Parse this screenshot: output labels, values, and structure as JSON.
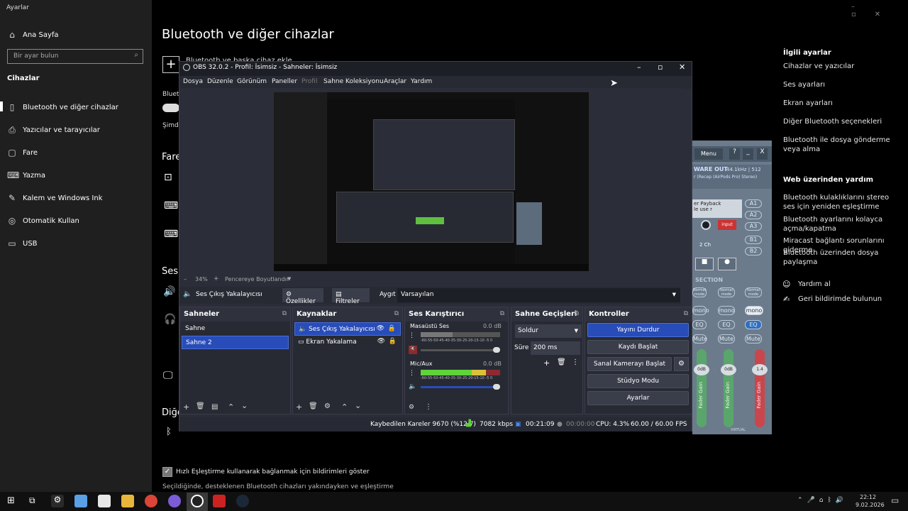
{
  "settings": {
    "window_title": "Ayarlar",
    "home": "Ana Sayfa",
    "search_placeholder": "Bir ayar bulun",
    "category": "Cihazlar",
    "nav": [
      "Bluetooth ve diğer cihazlar",
      "Yazıcılar ve tarayıcılar",
      "Fare",
      "Yazma",
      "Kalem ve Windows Ink",
      "Otomatik Kullan",
      "USB"
    ],
    "page_title": "Bluetooth ve diğer cihazlar",
    "add_device_partial": "Bluetooth ve başka cihaz ekle",
    "bluetooth_partial": "Blueto",
    "simdi_partial": "Şimdi",
    "fare_partial": "Fare",
    "ses_partial": "Ses",
    "diger_partial": "Diğe",
    "swift_pair_label": "Hızlı Eşleştirme kullanarak bağlanmak için bildirimleri göster",
    "swift_pair_desc": "Seçildiğinde, desteklenen Bluetooth cihazları yakındayken ve eşleştirme",
    "related_title": "İlgili ayarlar",
    "related": [
      "Cihazlar ve yazıcılar",
      "Ses ayarları",
      "Ekran ayarları",
      "Diğer Bluetooth seçenekleri",
      "Bluetooth ile dosya gönderme veya alma"
    ],
    "web_help_title": "Web üzerinden yardım",
    "web_help": [
      "Bluetooth kulaklıklarını stereo ses için yeniden eşleştirme",
      "Bluetooth ayarlarını kolayca açma/kapatma",
      "Miracast bağlantı sorunlarını giderme",
      "Bluetooth üzerinden dosya paylaşma"
    ],
    "get_help": "Yardım al",
    "feedback": "Geri bildirimde bulunun"
  },
  "obs": {
    "title": "OBS 32.0.2 - Profil: İsimsiz - Sahneler: İsimsiz",
    "menu": [
      "Dosya",
      "Düzenle",
      "Görünüm",
      "Paneller",
      "Profil",
      "Sahne Koleksiyonu",
      "Araçlar",
      "Yardım"
    ],
    "zoom": "34%",
    "fit": "Pencereye Boyutlandır",
    "source_name": "Ses Çıkış Yakalayıcısı",
    "properties": "Özellikler",
    "filters": "Filtreler",
    "device_label": "Aygıt",
    "device_value": "Varsayılan",
    "scenes_title": "Sahneler",
    "scenes": [
      "Sahne",
      "Sahne 2"
    ],
    "sources_title": "Kaynaklar",
    "sources": [
      "Ses Çıkış Yakalayıcısı",
      "Ekran Yakalama"
    ],
    "mixer_title": "Ses Karıştırıcı",
    "mixer": [
      {
        "name": "Masaüstü Ses",
        "db": "0.0 dB"
      },
      {
        "name": "Mic/Aux",
        "db": "0.0 dB"
      }
    ],
    "meter_ticks": "-60-55-50-45-40-35-30-25-20-15-10 -5 0",
    "transitions_title": "Sahne Geçişleri",
    "transition": "Soldur",
    "duration_label": "Süre",
    "duration": "200 ms",
    "controls_title": "Kontroller",
    "controls": [
      "Yayını Durdur",
      "Kaydı Başlat",
      "Sanal Kamerayı Başlat",
      "Stüdyo Modu",
      "Ayarlar"
    ],
    "status": {
      "dropped": "Kaybedilen Kareler 9670 (%12.7)",
      "bitrate": "7082 kbps",
      "live": "00:21:09",
      "rec": "00:00:00",
      "cpu": "CPU: 4.3%",
      "fps": "60.00 / 60.00 FPS"
    }
  },
  "voicemeeter": {
    "menu": "Menu",
    "q": "?",
    "min": "_",
    "close": "X",
    "hw_out": "WARE OUT",
    "hw_out_rate": "44.1kHz | 512",
    "hw_out_device": "r (Recep (AirPods Pro) Stereo)",
    "playback": "er Payback",
    "playback2": "le use r",
    "input": "input",
    "ch": "2 Ch",
    "buses": [
      "A1",
      "A2",
      "A3",
      "B1",
      "B2"
    ],
    "section": "SECTION",
    "mode": "Normal mode",
    "mono": "mono",
    "eq": "EQ",
    "mute": "Mute",
    "gain": [
      "0dB",
      "0dB",
      "1.4"
    ],
    "fader": "Fader Gain",
    "virtual": "VIRTUAL"
  },
  "taskbar": {
    "time": "22:12",
    "date": "9.02.2026"
  }
}
